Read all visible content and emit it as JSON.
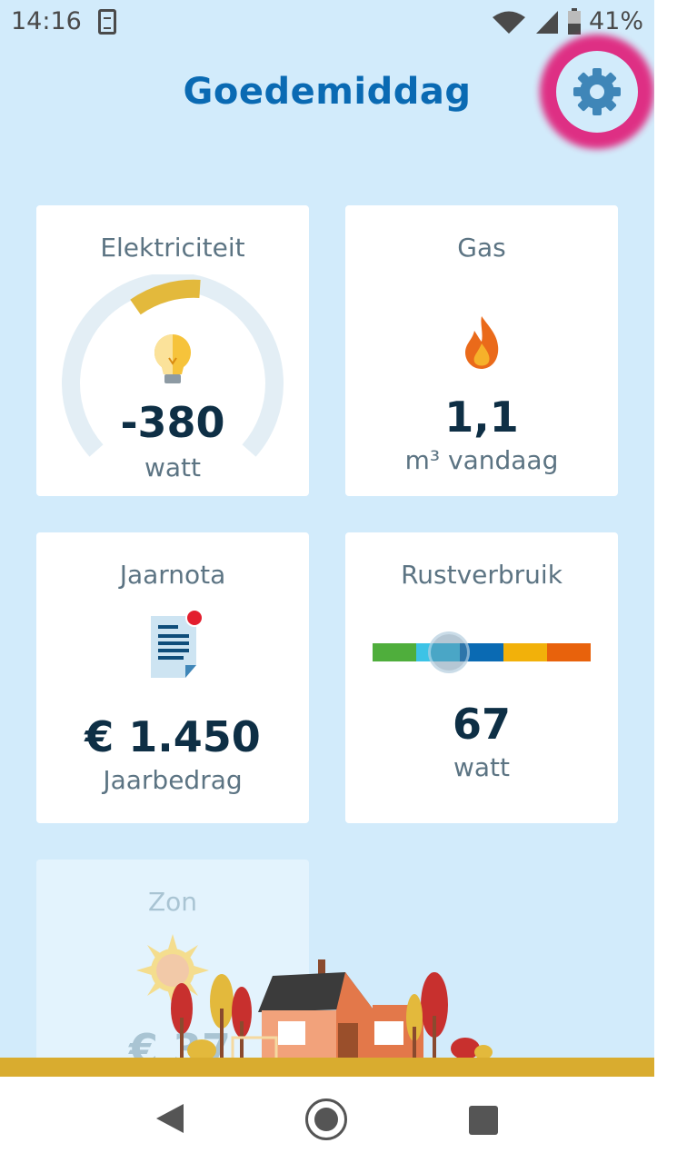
{
  "status_bar": {
    "time": "14:16",
    "battery_percent": "41%",
    "icons": [
      "sync-icon",
      "wifi-icon",
      "signal-icon",
      "battery-icon"
    ]
  },
  "header": {
    "greeting": "Goedemiddag",
    "settings_icon": "gear-icon"
  },
  "cards": {
    "electricity": {
      "title": "Elektriciteit",
      "value": "-380",
      "unit": "watt",
      "icon": "lightbulb-icon"
    },
    "gas": {
      "title": "Gas",
      "value": "1,1",
      "unit": "m³ vandaag",
      "icon": "flame-icon"
    },
    "annual_bill": {
      "title": "Jaarnota",
      "value": "€ 1.450",
      "unit": "Jaarbedrag",
      "icon": "document-icon",
      "notification": true
    },
    "base_load": {
      "title": "Rustverbruik",
      "value": "67",
      "unit": "watt",
      "scale_colors": [
        "#4fae3c",
        "#3cc3e6",
        "#0a6ab3",
        "#f2b10a",
        "#e8620c"
      ],
      "level": 0.35
    },
    "solar": {
      "title": "Zon",
      "value": "€ 37",
      "icon": "sun-icon"
    }
  },
  "colors": {
    "background": "#d2ebfb",
    "accent": "#0a6ab3",
    "highlight_ring": "#e0207a",
    "gauge_fill": "#e3b93c"
  },
  "nav_bar": {
    "back": "back-icon",
    "home": "home-icon",
    "recent": "recent-apps-icon"
  }
}
